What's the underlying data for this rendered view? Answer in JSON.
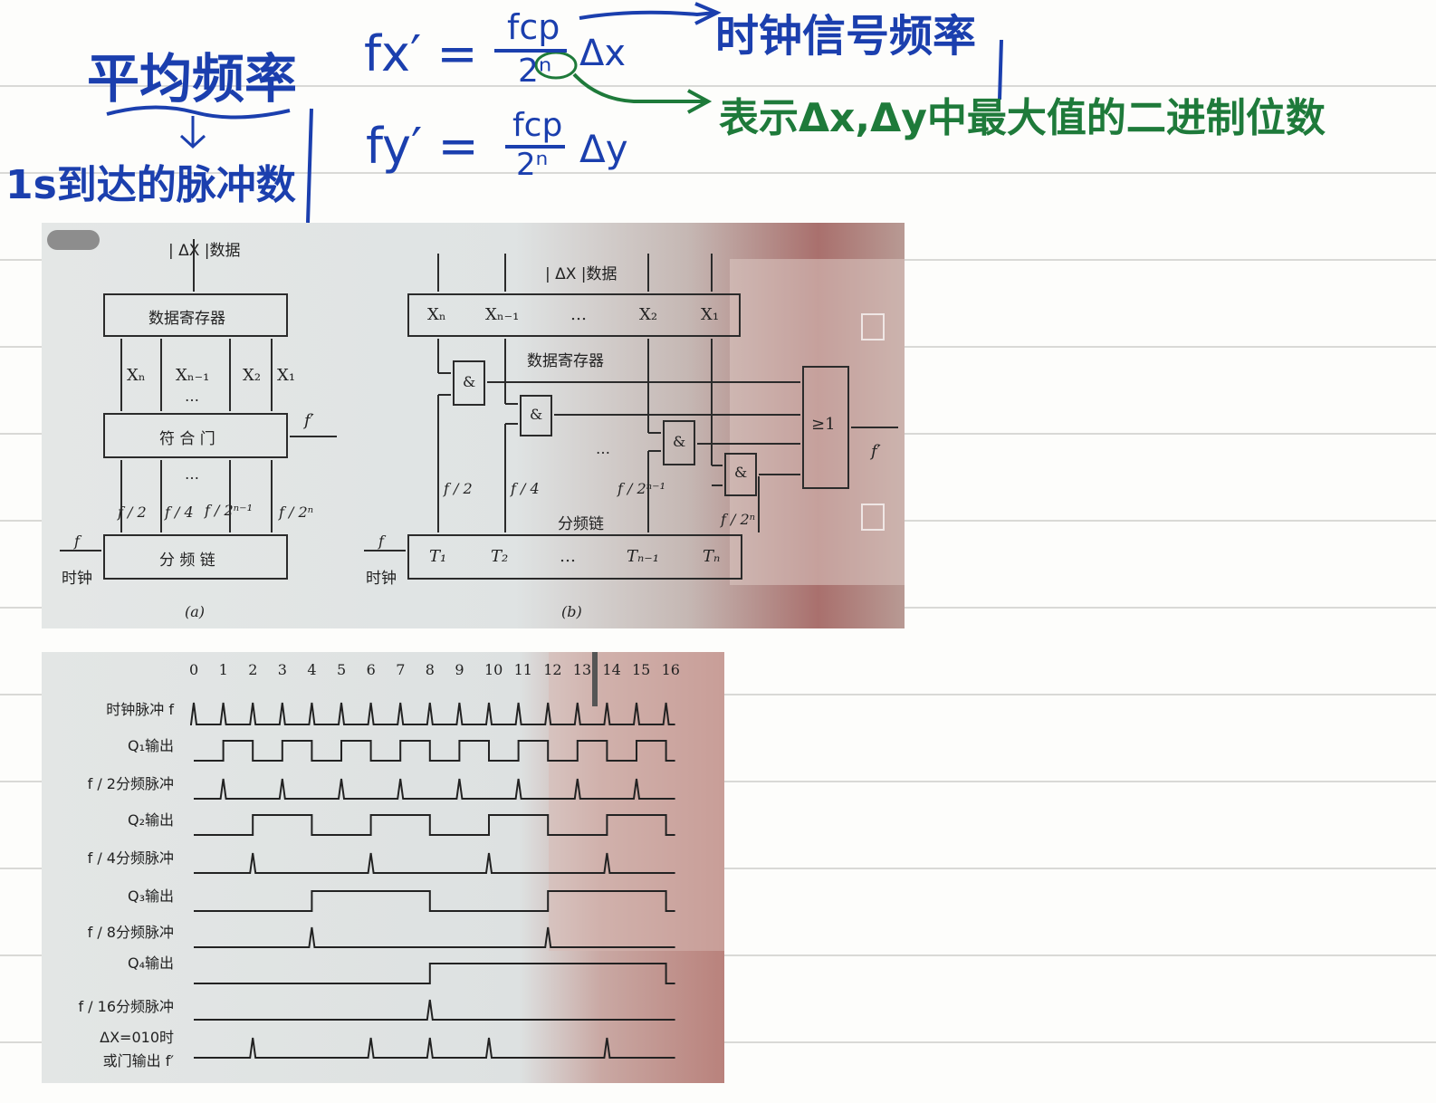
{
  "notes": {
    "title": "平均频率",
    "formula_x": {
      "lhs": "fx′ =",
      "num": "fcp",
      "den": "2ⁿ",
      "rhs": "Δx"
    },
    "formula_y": {
      "lhs": "fy′ =",
      "num": "fcp",
      "den": "2ⁿ",
      "rhs": "Δy"
    },
    "annot_clock": "时钟信号频率",
    "annot_bits": "表示Δx,Δy中最大值的二进制位数",
    "annot_pulses": "1s到达的脉冲数"
  },
  "diagram_a": {
    "data_label": "| ΔX |数据",
    "register": "数据寄存器",
    "bits": [
      "Xₙ",
      "Xₙ₋₁",
      "X₂",
      "X₁"
    ],
    "dots": "…",
    "gate": "符 合 门",
    "output": "f′",
    "taps": [
      "f / 2",
      "f / 4",
      "f / 2ⁿ⁻¹",
      "f / 2ⁿ"
    ],
    "divider": "分 频 链",
    "clock_f": "f",
    "clock": "时钟",
    "caption": "(a)"
  },
  "diagram_b": {
    "data_label": "| ΔX |数据",
    "bits": [
      "Xₙ",
      "Xₙ₋₁",
      "…",
      "X₂",
      "X₁"
    ],
    "register": "数据寄存器",
    "and": "&",
    "or": "≥1",
    "output": "f′",
    "taps": [
      "f / 2",
      "f / 4",
      "f / 2ⁿ⁻¹",
      "f / 2ⁿ"
    ],
    "divider": "分频链",
    "stages": [
      "T₁",
      "T₂",
      "…",
      "Tₙ₋₁",
      "Tₙ"
    ],
    "clock_f": "f",
    "clock": "时钟",
    "caption": "(b)"
  },
  "timing": {
    "ticks": [
      "0",
      "1",
      "2",
      "3",
      "4",
      "5",
      "6",
      "7",
      "8",
      "9",
      "10",
      "11",
      "12",
      "13",
      "14",
      "15",
      "16"
    ],
    "rows": [
      "时钟脉冲 f",
      "Q₁输出",
      "f / 2分频脉冲",
      "Q₂输出",
      "f / 4分频脉冲",
      "Q₃输出",
      "f / 8分频脉冲",
      "Q₄输出",
      "f / 16分频脉冲",
      "ΔX=010时",
      "或门输出 f′"
    ]
  }
}
